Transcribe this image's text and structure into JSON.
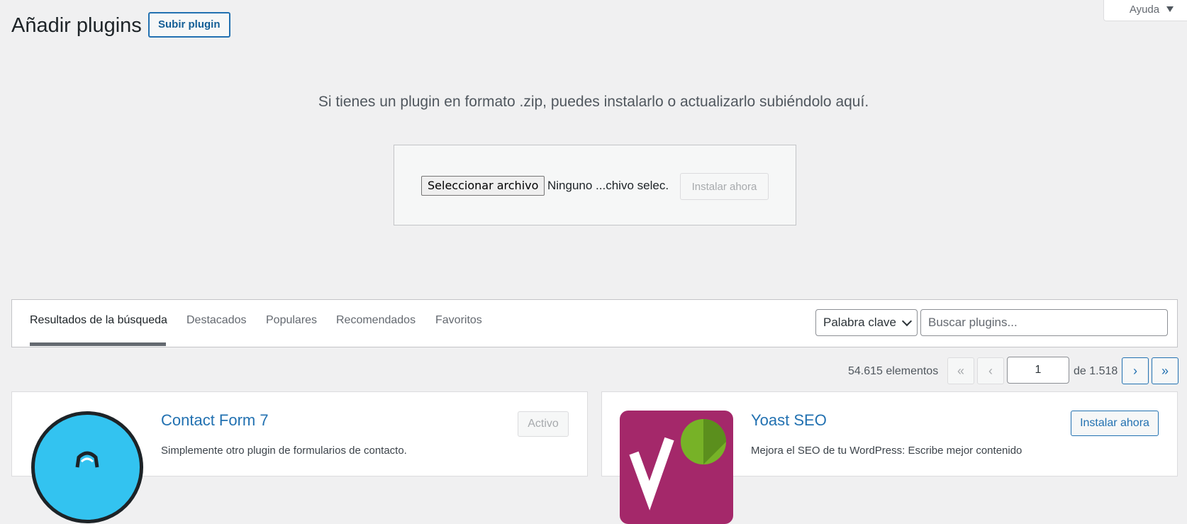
{
  "header": {
    "title": "Añadir plugins",
    "upload_button": "Subir plugin",
    "help_tab": "Ayuda"
  },
  "upload": {
    "message": "Si tienes un plugin en formato .zip, puedes instalarlo o actualizarlo subiéndolo aquí.",
    "file_button": "Seleccionar archivo",
    "file_status": "Ninguno ...chivo selec.",
    "install_button": "Instalar ahora"
  },
  "filters": {
    "tabs": [
      {
        "label": "Resultados de la búsqueda",
        "current": true
      },
      {
        "label": "Destacados",
        "current": false
      },
      {
        "label": "Populares",
        "current": false
      },
      {
        "label": "Recomendados",
        "current": false
      },
      {
        "label": "Favoritos",
        "current": false
      }
    ],
    "search_type": "Palabra clave",
    "search_placeholder": "Buscar plugins..."
  },
  "pagination": {
    "count": "54.615 elementos",
    "first": "«",
    "prev": "‹",
    "current_page": "1",
    "of_total": "de 1.518",
    "next": "›",
    "last": "»"
  },
  "plugins": [
    {
      "name": "Contact Form 7",
      "description": "Simplemente otro plugin de formularios de contacto.",
      "action": "Activo",
      "icon": "contact-form-7-icon"
    },
    {
      "name": "Yoast SEO",
      "description": "Mejora el SEO de tu WordPress: Escribe mejor contenido",
      "action": "Instalar ahora",
      "icon": "yoast-seo-icon"
    }
  ]
}
